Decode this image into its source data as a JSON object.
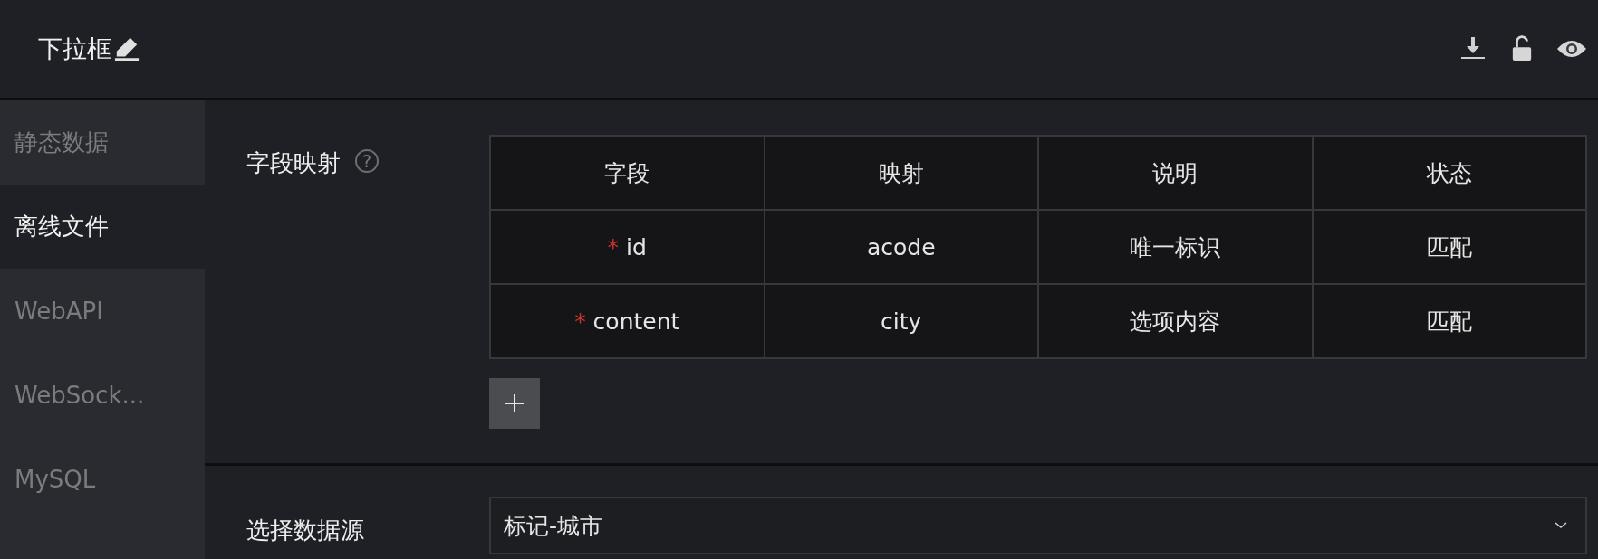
{
  "header": {
    "title": "下拉框"
  },
  "sidebar": {
    "items": [
      {
        "label": "静态数据",
        "selected": false
      },
      {
        "label": "离线文件",
        "selected": true
      },
      {
        "label": "WebAPI",
        "selected": false
      },
      {
        "label": "WebSock...",
        "selected": false
      },
      {
        "label": "MySQL",
        "selected": false
      }
    ]
  },
  "field_mapping": {
    "label": "字段映射",
    "help": "?",
    "columns": [
      "字段",
      "映射",
      "说明",
      "状态"
    ],
    "rows": [
      {
        "required_mark": "*",
        "field": "id",
        "mapping": "acode",
        "description": "唯一标识",
        "status": "匹配"
      },
      {
        "required_mark": "*",
        "field": "content",
        "mapping": "city",
        "description": "选项内容",
        "status": "匹配"
      }
    ]
  },
  "data_source": {
    "label": "选择数据源",
    "value": "标记-城市"
  }
}
